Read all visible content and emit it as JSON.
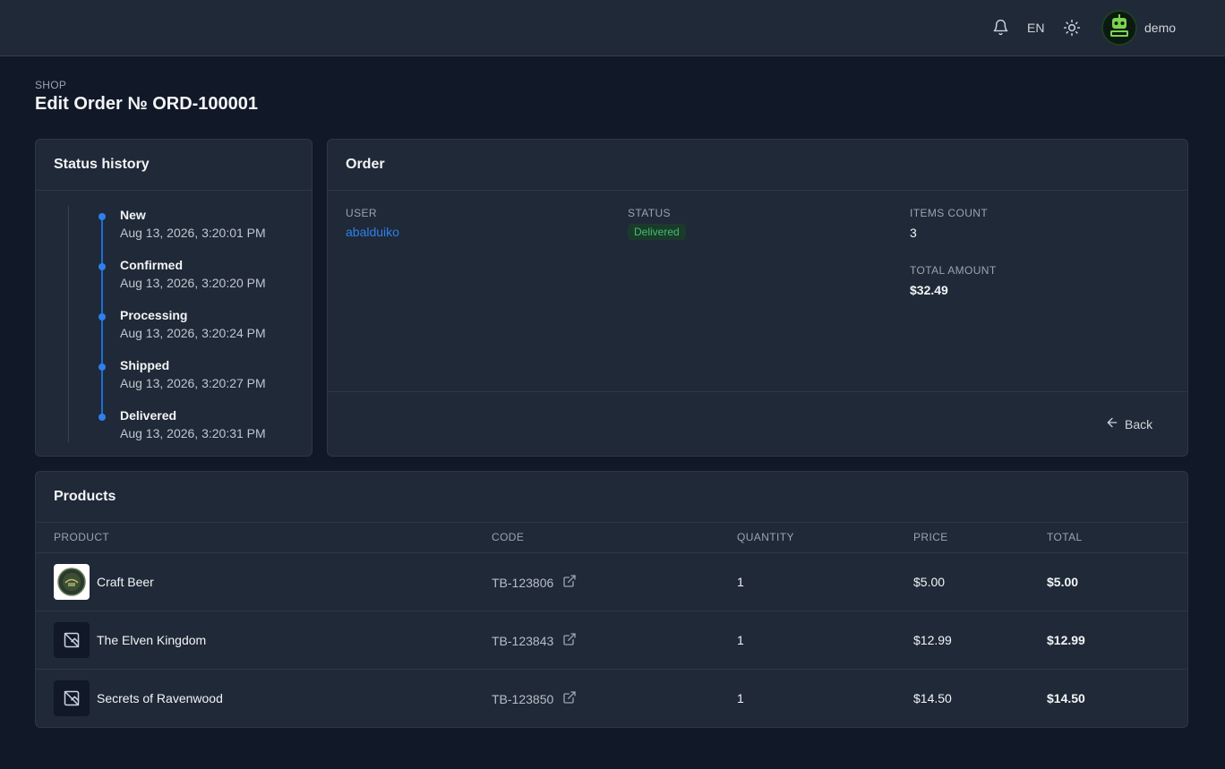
{
  "topbar": {
    "language": "EN",
    "username": "demo",
    "icons": [
      "bell-icon",
      "sun-icon",
      "avatar"
    ]
  },
  "header": {
    "breadcrumb": "SHOP",
    "title": "Edit Order № ORD-100001"
  },
  "status_history": {
    "title": "Status history",
    "items": [
      {
        "label": "New",
        "time": "Aug 13, 2026, 3:20:01 PM"
      },
      {
        "label": "Confirmed",
        "time": "Aug 13, 2026, 3:20:20 PM"
      },
      {
        "label": "Processing",
        "time": "Aug 13, 2026, 3:20:24 PM"
      },
      {
        "label": "Shipped",
        "time": "Aug 13, 2026, 3:20:27 PM"
      },
      {
        "label": "Delivered",
        "time": "Aug 13, 2026, 3:20:31 PM"
      }
    ]
  },
  "order": {
    "title": "Order",
    "user_label": "USER",
    "user_value": "abalduiko",
    "status_label": "STATUS",
    "status_value": "Delivered",
    "items_count_label": "ITEMS COUNT",
    "items_count_value": "3",
    "total_amount_label": "TOTAL AMOUNT",
    "total_amount_value": "$32.49",
    "back_label": "Back"
  },
  "products": {
    "title": "Products",
    "columns": [
      "PRODUCT",
      "CODE",
      "QUANTITY",
      "PRICE",
      "TOTAL"
    ],
    "rows": [
      {
        "name": "Craft Beer",
        "code": "TB-123806",
        "quantity": "1",
        "price": "$5.00",
        "total": "$5.00"
      },
      {
        "name": "The Elven Kingdom",
        "code": "TB-123843",
        "quantity": "1",
        "price": "$12.99",
        "total": "$12.99"
      },
      {
        "name": "Secrets of Ravenwood",
        "code": "TB-123850",
        "quantity": "1",
        "price": "$14.50",
        "total": "$14.50"
      }
    ]
  },
  "colors": {
    "accent": "#2f80ed",
    "success": "#3fbf6a",
    "background": "#111827",
    "card": "#1f2937"
  }
}
